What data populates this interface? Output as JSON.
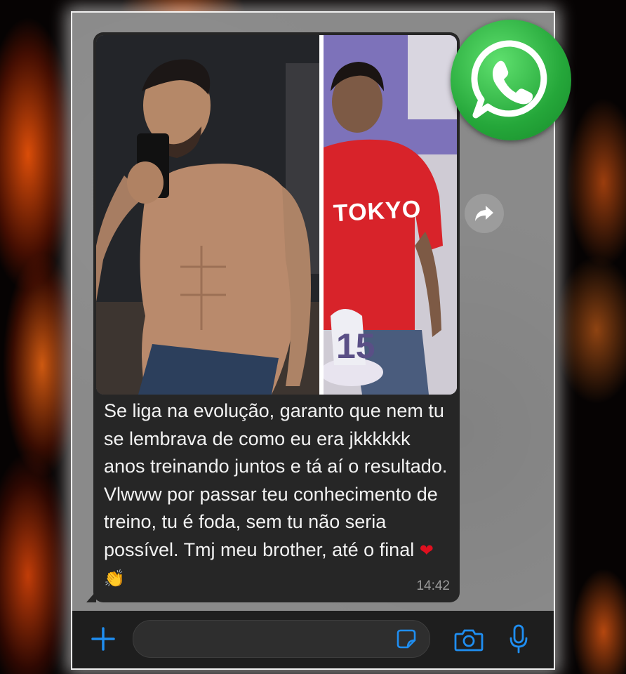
{
  "message": {
    "text": "Se liga na evolução, garanto que nem tu se lembrava de como eu era jkkkkkk anos treinando juntos e tá aí o resultado. Vlwww por passar teu conhecimento de treino, tu é foda, sem tu não seria possível. Tmj meu brother, até o final",
    "time": "14:42",
    "emoji_1": "❤",
    "emoji_2": "👏",
    "photo": {
      "shirt_text": "TOKYO"
    }
  },
  "icons": {
    "forward": "forward-arrow-icon",
    "logo": "whatsapp-logo-icon",
    "attach": "plus-icon",
    "sticker": "sticker-icon",
    "camera": "camera-icon",
    "mic": "microphone-icon"
  },
  "colors": {
    "accent": "#1f8ef1",
    "bubble": "#262626",
    "whatsapp_green": "#25a73a"
  }
}
